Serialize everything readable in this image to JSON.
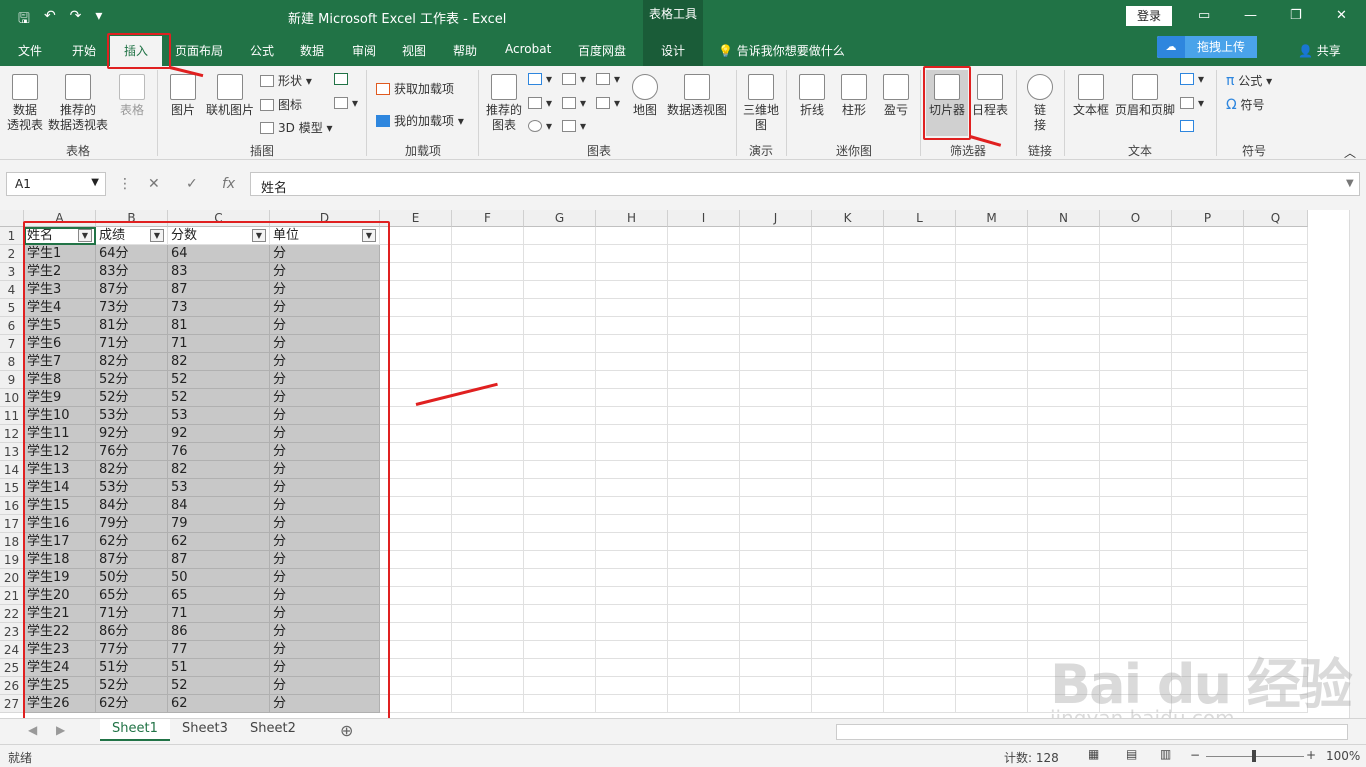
{
  "titlebar": {
    "title": "新建 Microsoft Excel 工作表  -  Excel",
    "table_tools": "表格工具",
    "login": "登录"
  },
  "tabs": [
    {
      "label": "文件"
    },
    {
      "label": "开始"
    },
    {
      "label": "插入"
    },
    {
      "label": "页面布局"
    },
    {
      "label": "公式"
    },
    {
      "label": "数据"
    },
    {
      "label": "审阅"
    },
    {
      "label": "视图"
    },
    {
      "label": "帮助"
    },
    {
      "label": "Acrobat"
    },
    {
      "label": "百度网盘"
    },
    {
      "label": "设计"
    }
  ],
  "tell_me": "告诉我你想要做什么",
  "upload_label": "拖拽上传",
  "share": "共享",
  "ribbon": {
    "pivot": "数据\n透视表",
    "rec_pivot": "推荐的\n数据透视表",
    "table": "表格",
    "picture": "图片",
    "online_picture": "联机图片",
    "shapes": "形状",
    "icons": "图标",
    "model3d": "3D 模型",
    "get_addins": "获取加载项",
    "my_addins": "我的加载项",
    "rec_charts": "推荐的\n图表",
    "map": "地图",
    "pivot_chart": "数据透视图",
    "map3d": "三维地\n图",
    "line": "折线",
    "column": "柱形",
    "winloss": "盈亏",
    "slicer": "切片器",
    "timeline": "日程表",
    "link": "链\n接",
    "textbox": "文本框",
    "header_footer": "页眉和页脚",
    "equation": "公式",
    "symbol": "符号",
    "groups": {
      "tables": "表格",
      "illustrations": "插图",
      "addins": "加载项",
      "charts": "图表",
      "tours": "演示",
      "sparklines": "迷你图",
      "filters": "筛选器",
      "links": "链接",
      "text": "文本",
      "symbols": "符号"
    }
  },
  "formula": {
    "name_box": "A1",
    "content": "姓名"
  },
  "columns": [
    "A",
    "B",
    "C",
    "D",
    "E",
    "F",
    "G",
    "H",
    "I",
    "J",
    "K",
    "L",
    "M",
    "N",
    "O",
    "P",
    "Q"
  ],
  "header_row": [
    "姓名",
    "成绩",
    "分数",
    "单位"
  ],
  "rows": [
    [
      "学生1",
      "64分",
      "64",
      "分"
    ],
    [
      "学生2",
      "83分",
      "83",
      "分"
    ],
    [
      "学生3",
      "87分",
      "87",
      "分"
    ],
    [
      "学生4",
      "73分",
      "73",
      "分"
    ],
    [
      "学生5",
      "81分",
      "81",
      "分"
    ],
    [
      "学生6",
      "71分",
      "71",
      "分"
    ],
    [
      "学生7",
      "82分",
      "82",
      "分"
    ],
    [
      "学生8",
      "52分",
      "52",
      "分"
    ],
    [
      "学生9",
      "52分",
      "52",
      "分"
    ],
    [
      "学生10",
      "53分",
      "53",
      "分"
    ],
    [
      "学生11",
      "92分",
      "92",
      "分"
    ],
    [
      "学生12",
      "76分",
      "76",
      "分"
    ],
    [
      "学生13",
      "82分",
      "82",
      "分"
    ],
    [
      "学生14",
      "53分",
      "53",
      "分"
    ],
    [
      "学生15",
      "84分",
      "84",
      "分"
    ],
    [
      "学生16",
      "79分",
      "79",
      "分"
    ],
    [
      "学生17",
      "62分",
      "62",
      "分"
    ],
    [
      "学生18",
      "87分",
      "87",
      "分"
    ],
    [
      "学生19",
      "50分",
      "50",
      "分"
    ],
    [
      "学生20",
      "65分",
      "65",
      "分"
    ],
    [
      "学生21",
      "71分",
      "71",
      "分"
    ],
    [
      "学生22",
      "86分",
      "86",
      "分"
    ],
    [
      "学生23",
      "77分",
      "77",
      "分"
    ],
    [
      "学生24",
      "51分",
      "51",
      "分"
    ],
    [
      "学生25",
      "52分",
      "52",
      "分"
    ],
    [
      "学生26",
      "62分",
      "62",
      "分"
    ]
  ],
  "sheets": [
    "Sheet1",
    "Sheet3",
    "Sheet2"
  ],
  "status": {
    "ready": "就绪",
    "count": "计数: 128",
    "zoom": "100%"
  },
  "watermark": {
    "brand": "Bai du 经验",
    "url": "jingyan.baidu.com"
  },
  "colors": {
    "excel_green": "#217346",
    "annotation_red": "#e02020",
    "selection_gray": "#c8c8c8"
  }
}
